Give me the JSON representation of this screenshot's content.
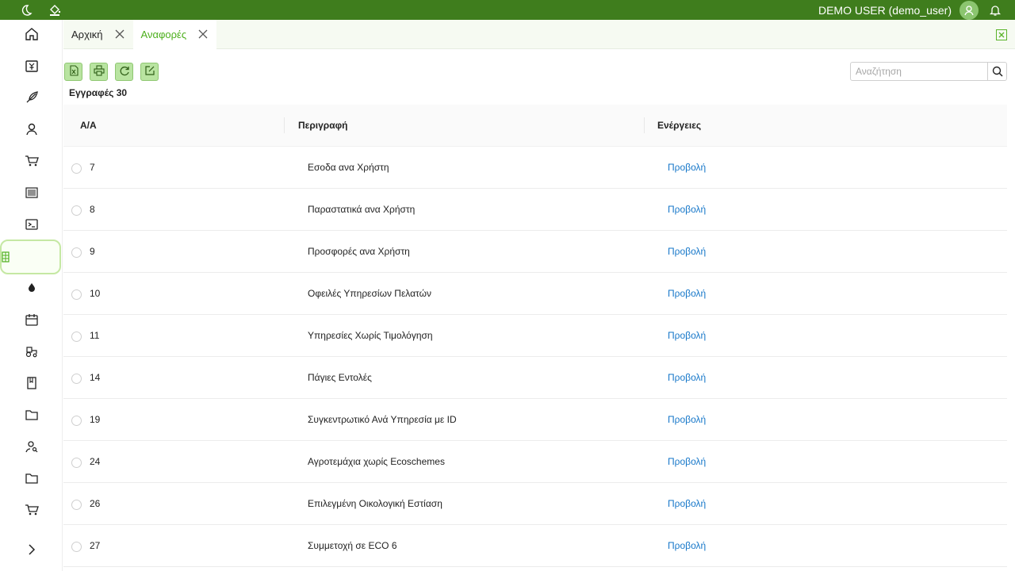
{
  "topbar": {
    "user_name": "DEMO USER (demo_user)",
    "bg_color": "#3f7d1d"
  },
  "sidebar": {
    "items": [
      {
        "icon": "home-icon"
      },
      {
        "icon": "invoice-yen-icon"
      },
      {
        "icon": "feather-icon"
      },
      {
        "icon": "user-icon"
      },
      {
        "icon": "cart-icon"
      },
      {
        "icon": "barcode-icon"
      },
      {
        "icon": "terminal-icon"
      },
      {
        "icon": "table-icon",
        "active": true
      },
      {
        "icon": "drop-icon"
      },
      {
        "icon": "calendar-icon"
      },
      {
        "icon": "tractor-icon"
      },
      {
        "icon": "book-icon"
      },
      {
        "icon": "folder-icon"
      },
      {
        "icon": "user-search-icon"
      },
      {
        "icon": "folder-icon"
      },
      {
        "icon": "cart-icon"
      }
    ]
  },
  "tabs": [
    {
      "label": "Αρχική",
      "active": false
    },
    {
      "label": "Αναφορές",
      "active": true
    }
  ],
  "search": {
    "placeholder": "Αναζήτηση",
    "value": ""
  },
  "records": {
    "label": "Εγγραφές 30"
  },
  "table": {
    "columns": [
      "Α/Α",
      "Περιγραφή",
      "Ενέργειες"
    ],
    "rows": [
      {
        "id": "7",
        "description": "Εσοδα ανα Χρήστη",
        "action": "Προβολή"
      },
      {
        "id": "8",
        "description": "Παραστατικά ανα Χρήστη",
        "action": "Προβολή"
      },
      {
        "id": "9",
        "description": "Προσφορές ανα Χρήστη",
        "action": "Προβολή"
      },
      {
        "id": "10",
        "description": "Οφειλές Υπηρεσίων Πελατών",
        "action": "Προβολή"
      },
      {
        "id": "11",
        "description": "Υπηρεσίες Χωρίς Τιμολόγηση",
        "action": "Προβολή"
      },
      {
        "id": "14",
        "description": "Πάγιες Εντολές",
        "action": "Προβολή"
      },
      {
        "id": "19",
        "description": "Συγκεντρωτικό Ανά Υπηρεσία με ID",
        "action": "Προβολή"
      },
      {
        "id": "24",
        "description": "Αγροτεμάχια χωρίς Ecoschemes",
        "action": "Προβολή"
      },
      {
        "id": "26",
        "description": "Επιλεγμένη Οικολογική Εστίαση",
        "action": "Προβολή"
      },
      {
        "id": "27",
        "description": "Συμμετοχή σε ECO 6",
        "action": "Προβολή"
      }
    ]
  },
  "colors": {
    "accent": "#4caf1c",
    "link": "#1677c9",
    "toolbar_button": "#b9e4a1"
  }
}
